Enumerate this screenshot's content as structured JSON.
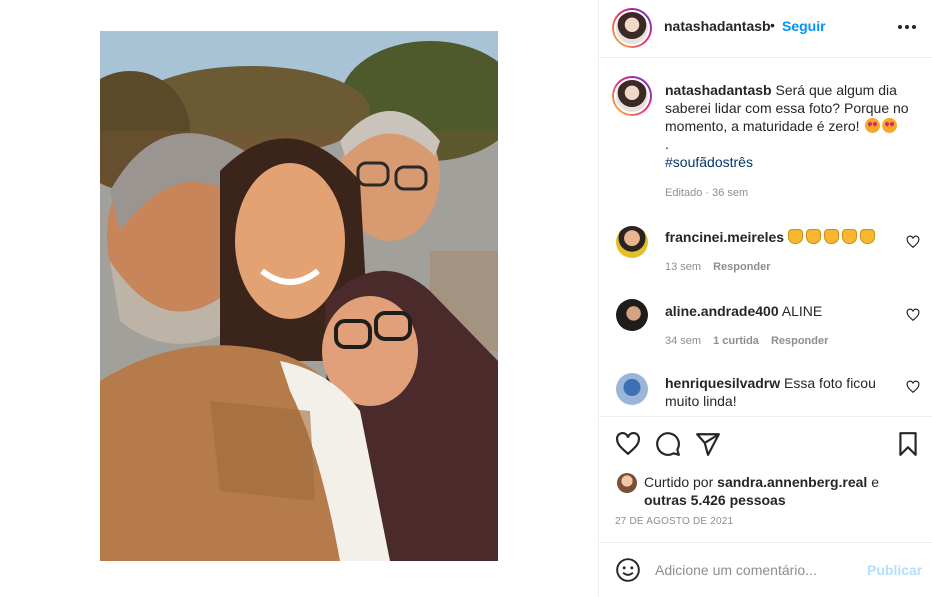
{
  "post": {
    "author": "natashadantasb",
    "separator": "•",
    "follow_label": "Seguir",
    "more_icon": "more-horizontal-icon",
    "photo_icon": "photo"
  },
  "caption": {
    "username": "natashadantasb",
    "text": "Será que algum dia saberei lidar com essa foto? Porque no momento, a maturidade é zero!",
    "dot": ".",
    "hashtag": "#soufãdostrês",
    "edited": "Editado",
    "time": "36 sem"
  },
  "comments": [
    {
      "username": "francinei.meireles",
      "text": "",
      "emoji": "clapping-hands",
      "emoji_count": 5,
      "time": "13 sem",
      "likes": "",
      "reply": "Responder"
    },
    {
      "username": "aline.andrade400",
      "text": "ALINE",
      "time": "34 sem",
      "likes": "1 curtida",
      "reply": "Responder"
    },
    {
      "username": "henriquesilvadrw",
      "text": "Essa foto ficou muito linda!",
      "time": "",
      "likes": "",
      "reply": ""
    }
  ],
  "actions": {
    "like_icon": "heart-icon",
    "comment_icon": "comment-icon",
    "share_icon": "send-icon",
    "save_icon": "bookmark-icon"
  },
  "likes": {
    "prefix": "Curtido por",
    "user": "sandra.annenberg.real",
    "middle": "e",
    "others": "outras 5.426 pessoas"
  },
  "date": "27 DE AGOSTO DE 2021",
  "comment_box": {
    "placeholder": "Adicione um comentário...",
    "publish_label": "Publicar"
  },
  "colors": {
    "link": "#0095f6",
    "hashtag": "#00376b",
    "muted": "#8e8e8e",
    "publish_disabled": "#b2dffc"
  }
}
